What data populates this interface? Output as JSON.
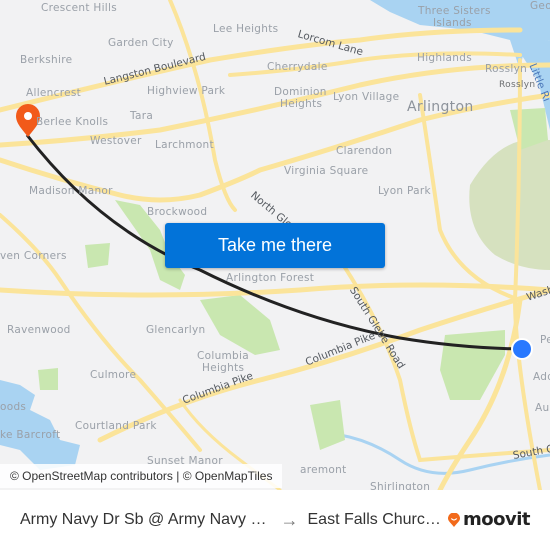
{
  "map": {
    "places": [
      {
        "name": "crescent-hills",
        "label": "Crescent Hills"
      },
      {
        "name": "lee-heights",
        "label": "Lee Heights"
      },
      {
        "name": "three-sisters",
        "label": "Three Sisters"
      },
      {
        "name": "islands",
        "label": "Islands"
      },
      {
        "name": "georgetown",
        "label": "Geo"
      },
      {
        "name": "garden-city",
        "label": "Garden City"
      },
      {
        "name": "berkshire",
        "label": "Berkshire"
      },
      {
        "name": "cherrydale",
        "label": "Cherrydale"
      },
      {
        "name": "highlands",
        "label": "Highlands"
      },
      {
        "name": "rosslyn",
        "label": "Rosslyn"
      },
      {
        "name": "rosslyn-station",
        "label": "Rosslyn"
      },
      {
        "name": "allencrest",
        "label": "Allencrest"
      },
      {
        "name": "highview-park",
        "label": "Highview Park"
      },
      {
        "name": "dominion-heights-1",
        "label": "Dominion"
      },
      {
        "name": "dominion-heights-2",
        "label": "Heights"
      },
      {
        "name": "lyon-village",
        "label": "Lyon Village"
      },
      {
        "name": "arlington",
        "label": "Arlington"
      },
      {
        "name": "tara",
        "label": "Tara"
      },
      {
        "name": "berlee-knolls",
        "label": "Berlee Knolls"
      },
      {
        "name": "westover",
        "label": "Westover"
      },
      {
        "name": "larchmont",
        "label": "Larchmont"
      },
      {
        "name": "clarendon",
        "label": "Clarendon"
      },
      {
        "name": "virginia-square",
        "label": "Virginia Square"
      },
      {
        "name": "madison-manor",
        "label": "Madison Manor"
      },
      {
        "name": "lyon-park",
        "label": "Lyon Park"
      },
      {
        "name": "brockwood",
        "label": "Brockwood"
      },
      {
        "name": "seven-corners",
        "label": "ven Corners"
      },
      {
        "name": "arlington-forest",
        "label": "Arlington Forest"
      },
      {
        "name": "ravenwood",
        "label": "Ravenwood"
      },
      {
        "name": "glencarlyn",
        "label": "Glencarlyn"
      },
      {
        "name": "columbia-heights-1",
        "label": "Columbia"
      },
      {
        "name": "columbia-heights-2",
        "label": "Heights"
      },
      {
        "name": "culmore",
        "label": "Culmore"
      },
      {
        "name": "woods",
        "label": "oods"
      },
      {
        "name": "lake-barcroft",
        "label": "ke Barcroft"
      },
      {
        "name": "courtland-park",
        "label": "Courtland Park"
      },
      {
        "name": "sunset-manor",
        "label": "Sunset Manor"
      },
      {
        "name": "claremont",
        "label": "aremont"
      },
      {
        "name": "shirlington",
        "label": "Shirlington"
      },
      {
        "name": "pentagon",
        "label": "Pe"
      },
      {
        "name": "addison",
        "label": "Add"
      },
      {
        "name": "aurora",
        "label": "Auror"
      }
    ],
    "roads": {
      "langston": "Langston Boulevard",
      "lorcom": "Lorcom Lane",
      "north_glebe": "North Glebe",
      "south_glebe": "South Glebe Road",
      "columbia_pike_1": "Columbia Pike",
      "columbia_pike_2": "Columbia Pike",
      "washington": "Wash",
      "south_g": "South G",
      "little_river": "Little Ri"
    },
    "colors": {
      "background": "#f2f2f3",
      "road": "#fbe49a",
      "water": "#a9d3f2",
      "park": "#c9e7b0",
      "route": "#222222",
      "origin_marker": "#2979ff",
      "destination_marker": "#f25a1a"
    }
  },
  "cta": {
    "label": "Take me there"
  },
  "attribution": "© OpenStreetMap contributors | © OpenMapTiles",
  "footer": {
    "origin": "Army Navy Dr Sb @ Army Navy …",
    "arrow": "→",
    "destination": "East Falls Churc…",
    "brand": "moovit"
  }
}
